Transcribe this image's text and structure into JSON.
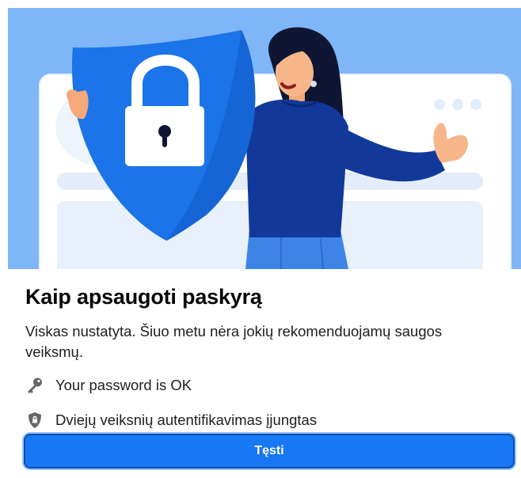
{
  "dialog": {
    "title": "Kaip apsaugoti paskyrą",
    "description": "Viskas nustatyta. Šiuo metu nėra jokių rekomenduojamų saugos veiksmų.",
    "items": [
      {
        "icon": "key-icon",
        "label": "Your password is OK"
      },
      {
        "icon": "shield-icon",
        "label": "Dviejų veiksnių autentifikavimas įjungtas"
      }
    ],
    "continue_label": "Tęsti"
  },
  "colors": {
    "accent": "#1877f2",
    "hero_background": "#7fb6f7",
    "shield": "#1b74e8",
    "sweater": "#12399a"
  }
}
